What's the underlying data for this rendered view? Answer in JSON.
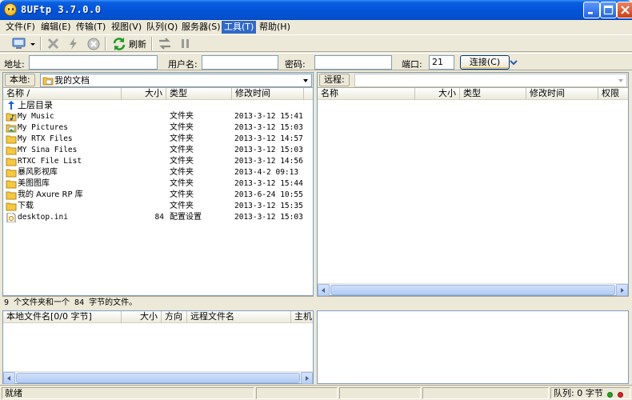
{
  "window": {
    "title": "8UFtp 3.7.0.0"
  },
  "menu": {
    "items": [
      {
        "label": "文件(F)"
      },
      {
        "label": "编辑(E)"
      },
      {
        "label": "传输(T)"
      },
      {
        "label": "视图(V)"
      },
      {
        "label": "队列(Q)"
      },
      {
        "label": "服务器(S)"
      },
      {
        "label": "工具(T)",
        "active": true
      },
      {
        "label": "帮助(H)"
      }
    ]
  },
  "toolbar": {
    "refresh_label": "刷新",
    "icons": [
      "site-manager-icon",
      "dropdown-arrow-icon",
      "disconnect-icon",
      "quick-connect-icon",
      "stop-icon",
      "refresh-icon",
      "transfer-icon",
      "pause-icon"
    ]
  },
  "address": {
    "host_label": "地址:",
    "host_value": "",
    "user_label": "用户名:",
    "user_value": "",
    "password_label": "密码:",
    "password_value": "",
    "port_label": "端口:",
    "port_value": "21",
    "connect_label": "连接(C)"
  },
  "local": {
    "label": "本地:",
    "path": "我的文档",
    "columns": [
      "名称 /",
      "大小",
      "类型",
      "修改时间"
    ],
    "parent_label": "上层目录",
    "files": [
      {
        "name": "My Music",
        "size": "",
        "type": "文件夹",
        "modified": "2013-3-12 15:41",
        "icon": "music-folder-icon"
      },
      {
        "name": "My Pictures",
        "size": "",
        "type": "文件夹",
        "modified": "2013-3-12 15:03",
        "icon": "pictures-folder-icon"
      },
      {
        "name": "My RTX Files",
        "size": "",
        "type": "文件夹",
        "modified": "2013-3-12 14:57",
        "icon": "folder-icon"
      },
      {
        "name": "MY Sina Files",
        "size": "",
        "type": "文件夹",
        "modified": "2013-3-12 15:03",
        "icon": "folder-icon"
      },
      {
        "name": "RTXC File List",
        "size": "",
        "type": "文件夹",
        "modified": "2013-3-12 14:56",
        "icon": "folder-icon"
      },
      {
        "name": "暴风影视库",
        "size": "",
        "type": "文件夹",
        "modified": "2013-4-2 09:13",
        "icon": "folder-icon"
      },
      {
        "name": "美图图库",
        "size": "",
        "type": "文件夹",
        "modified": "2013-3-12 15:44",
        "icon": "folder-icon"
      },
      {
        "name": "我的 Axure RP 库",
        "size": "",
        "type": "文件夹",
        "modified": "2013-6-24 10:55",
        "icon": "folder-icon"
      },
      {
        "name": "下载",
        "size": "",
        "type": "文件夹",
        "modified": "2013-3-12 15:35",
        "icon": "folder-icon"
      },
      {
        "name": "desktop.ini",
        "size": "84",
        "type": "配置设置",
        "modified": "2013-3-12 15:03",
        "icon": "config-file-icon"
      }
    ],
    "summary": "9 个文件夹和一个 84 字节的文件。"
  },
  "remote": {
    "label": "远程:",
    "path": "",
    "columns": [
      "名称",
      "大小",
      "类型",
      "修改时间",
      "权限"
    ]
  },
  "queue": {
    "columns": [
      "本地文件名[0/0 字节]",
      "大小",
      "方向",
      "远程文件名",
      "主机"
    ]
  },
  "status": {
    "text": "就绪",
    "queue": "队列: 0 字节"
  },
  "colors": {
    "title_bar": "#0453d8",
    "menu_highlight": "#316ac5",
    "folder": "#f5c842",
    "status_green": "#2ca02c",
    "status_red": "#d62728"
  }
}
